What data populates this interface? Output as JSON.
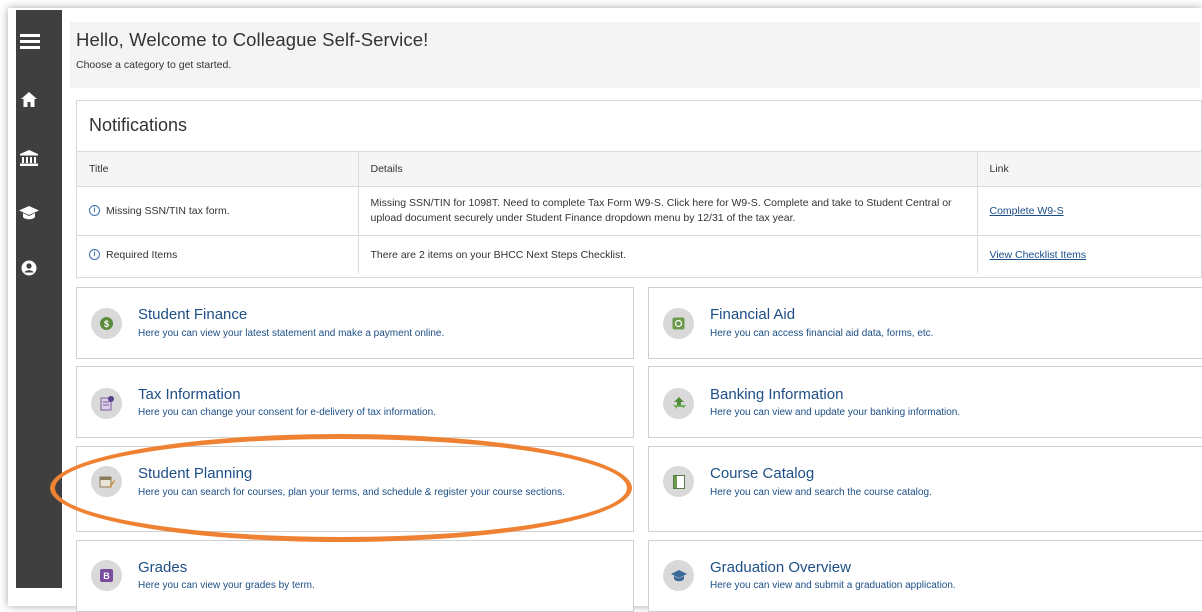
{
  "welcome": {
    "title": "Hello, Welcome to Colleague Self-Service!",
    "subtitle": "Choose a category to get started."
  },
  "sidebar": {
    "icons": [
      "menu-icon",
      "home-icon",
      "bank-icon",
      "graduation-cap-icon",
      "user-icon"
    ]
  },
  "notifications": {
    "title": "Notifications",
    "columns": [
      "Title",
      "Details",
      "Link"
    ],
    "rows": [
      {
        "title": "Missing SSN/TIN tax form.",
        "details": "Missing SSN/TIN for 1098T. Need to complete Tax Form W9-S. Click here for W9-S. Complete and take to Student Central or upload document securely under Student Finance dropdown menu by 12/31 of the tax year.",
        "link": "Complete W9-S"
      },
      {
        "title": "Required Items",
        "details": "There are 2 items on your BHCC Next Steps Checklist.",
        "link": "View Checklist Items"
      }
    ]
  },
  "tiles": [
    {
      "title": "Student Finance",
      "desc": "Here you can view your latest statement and make a payment online.",
      "icon": "dollar-icon"
    },
    {
      "title": "Financial Aid",
      "desc": "Here you can access financial aid data, forms, etc.",
      "icon": "money-icon"
    },
    {
      "title": "Tax Information",
      "desc": "Here you can change your consent for e-delivery of tax information.",
      "icon": "tax-document-icon"
    },
    {
      "title": "Banking Information",
      "desc": "Here you can view and update your banking information.",
      "icon": "recycle-money-icon"
    },
    {
      "title": "Student Planning",
      "desc": "Here you can search for courses, plan your terms, and schedule & register your course sections.",
      "icon": "calendar-pencil-icon"
    },
    {
      "title": "Course Catalog",
      "desc": "Here you can view and search the course catalog.",
      "icon": "book-icon"
    },
    {
      "title": "Grades",
      "desc": "Here you can view your grades by term.",
      "icon": "grade-letter-icon"
    },
    {
      "title": "Graduation Overview",
      "desc": "Here you can view and submit a graduation application.",
      "icon": "graduation-cap-icon"
    }
  ],
  "colors": {
    "sidebar": "#3f3f3f",
    "tile_text": "#1d4f86",
    "highlight": "#ef8232"
  }
}
